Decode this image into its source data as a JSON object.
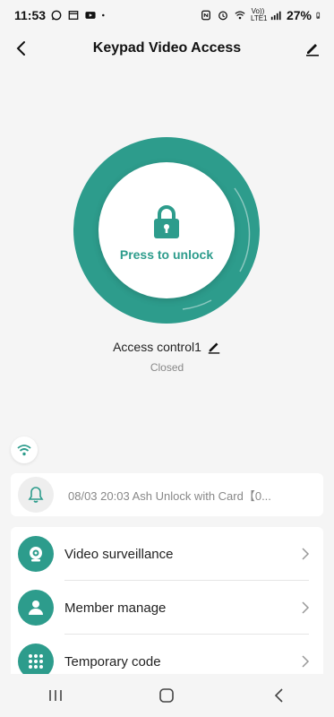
{
  "status_bar": {
    "time": "11:53",
    "left_icons": [
      "whatsapp-icon",
      "gallery-icon",
      "youtube-icon",
      "dot-icon"
    ],
    "right_icons": [
      "nfc-icon",
      "alarm-icon",
      "wifi-icon",
      "volte-icon",
      "signal-icon"
    ],
    "network_label": "Vo)) LTE1",
    "battery_percent": "27%"
  },
  "header": {
    "title": "Keypad Video Access",
    "back_icon": "chevron-left-icon",
    "edit_icon": "pencil-icon"
  },
  "lock": {
    "unlock_label": "Press to unlock",
    "icon": "lock-icon",
    "accent_color": "#2d9c8c"
  },
  "device": {
    "name": "Access control1",
    "state": "Closed",
    "edit_icon": "pencil-icon"
  },
  "log": {
    "text": "08/03 20:03 Ash  Unlock with Card【0...",
    "icon": "bell-icon"
  },
  "menu": {
    "items": [
      {
        "label": "Video surveillance",
        "icon": "camera-icon"
      },
      {
        "label": "Member manage",
        "icon": "person-icon"
      },
      {
        "label": "Temporary code",
        "icon": "keypad-icon"
      }
    ]
  },
  "nav": {
    "icons": [
      "recent-apps-icon",
      "home-icon",
      "back-icon"
    ]
  }
}
